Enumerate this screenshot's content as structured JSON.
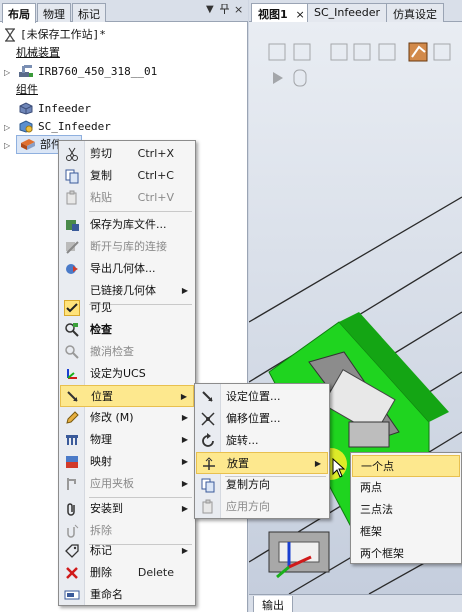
{
  "left_panel": {
    "tabs": [
      "布局",
      "物理",
      "标记"
    ],
    "controls": [
      "▼",
      "📌",
      "×"
    ],
    "tree": {
      "station": "[未保存工作站]*",
      "mechanisms_header": "机械装置",
      "robot": "IRB760_450_318__01",
      "components_header": "组件",
      "infeeder": "Infeeder",
      "sc_infeeder": "SC_Infeeder",
      "part": "部件"
    }
  },
  "viewport": {
    "tabs": [
      "视图1",
      "×",
      "SC_Infeeder",
      "仿真设定"
    ],
    "output_tab": "输出"
  },
  "context_menu": {
    "items": [
      {
        "label": "剪切",
        "shortcut": "Ctrl+X",
        "icon": "scissors-icon"
      },
      {
        "label": "复制",
        "shortcut": "Ctrl+C",
        "icon": "copy-icon"
      },
      {
        "label": "粘贴",
        "shortcut": "Ctrl+V",
        "icon": "paste-icon"
      },
      {
        "label": "保存为库文件...",
        "icon": "save-library-icon"
      },
      {
        "label": "断开与库的连接",
        "icon": "disconnect-library-icon"
      },
      {
        "label": "导出几何体...",
        "icon": "export-geometry-icon"
      },
      {
        "label": "已链接几何体",
        "arrow": "▶"
      },
      {
        "label": "可见",
        "icon": "check-icon"
      },
      {
        "label": "检查",
        "icon": "examine-icon"
      },
      {
        "label": "撤消检查",
        "icon": "undo-examine-icon"
      },
      {
        "label": "设定为UCS",
        "icon": "ucs-icon"
      },
      {
        "label": "位置",
        "arrow": "▶",
        "icon": "position-icon"
      },
      {
        "label": "修改 (M)",
        "arrow": "▶",
        "icon": "pencil-icon"
      },
      {
        "label": "物理",
        "arrow": "▶",
        "icon": "physics-icon"
      },
      {
        "label": "映射",
        "arrow": "▶",
        "icon": "mapping-icon"
      },
      {
        "label": "应用夹板",
        "arrow": "▶",
        "icon": "clamp-icon"
      },
      {
        "label": "安装到",
        "arrow": "▶",
        "icon": "attach-icon"
      },
      {
        "label": "拆除",
        "icon": "detach-icon"
      },
      {
        "label": "标记",
        "arrow": "▶",
        "icon": "tag-icon"
      },
      {
        "label": "删除",
        "shortcut": "Delete",
        "icon": "delete-icon"
      },
      {
        "label": "重命名",
        "icon": "rename-icon"
      }
    ]
  },
  "position_submenu": {
    "items": [
      {
        "label": "设定位置...",
        "icon": "set-position-icon"
      },
      {
        "label": "偏移位置...",
        "icon": "offset-position-icon"
      },
      {
        "label": "旋转...",
        "icon": "rotate-icon"
      },
      {
        "label": "放置",
        "arrow": "▶",
        "icon": "place-icon"
      },
      {
        "label": "复制方向",
        "icon": "copy-orientation-icon"
      },
      {
        "label": "应用方向",
        "icon": "apply-orientation-icon"
      }
    ]
  },
  "place_submenu": {
    "items": [
      "一个点",
      "两点",
      "三点法",
      "框架",
      "两个框架"
    ]
  },
  "colors": {
    "highlight": "#fde88e",
    "scene_background": "#d6dde8",
    "conveyor_green": "#1fd41f"
  }
}
